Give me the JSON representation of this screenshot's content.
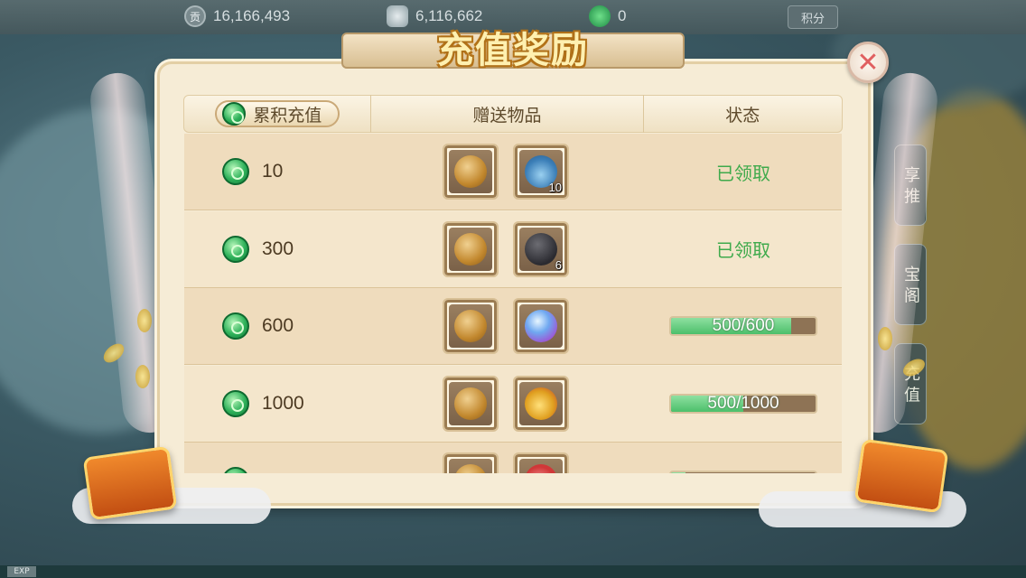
{
  "topbar": {
    "resources": [
      {
        "icon": "contribution-icon",
        "glyph": "贡",
        "value": "16,166,493"
      },
      {
        "icon": "silver-icon",
        "glyph": "",
        "value": "6,116,662"
      },
      {
        "icon": "jade-icon",
        "glyph": "",
        "value": "0"
      }
    ],
    "points_label": "积分"
  },
  "side_menu": [
    "享 推",
    "宝 阁",
    "充 值"
  ],
  "dialog": {
    "title": "充值奖励",
    "close_label": "✕",
    "columns": {
      "cumulative": "累积充值",
      "gifts": "赠送物品",
      "status": "状态"
    },
    "rows": [
      {
        "amount": "10",
        "items": [
          {
            "icon": "silver-bag-icon",
            "qty": ""
          },
          {
            "icon": "herb-vase-icon",
            "qty": "10"
          }
        ],
        "status_type": "claimed",
        "status": "已领取",
        "progress": null
      },
      {
        "amount": "300",
        "items": [
          {
            "icon": "silver-bag-icon",
            "qty": ""
          },
          {
            "icon": "black-stone-icon",
            "qty": "6"
          }
        ],
        "status_type": "claimed",
        "status": "已领取",
        "progress": null
      },
      {
        "amount": "600",
        "items": [
          {
            "icon": "silver-bag-icon",
            "qty": ""
          },
          {
            "icon": "crystal-orb-icon",
            "qty": ""
          }
        ],
        "status_type": "progress",
        "status": "500/600",
        "progress": 0.833
      },
      {
        "amount": "1000",
        "items": [
          {
            "icon": "silver-bag-icon",
            "qty": ""
          },
          {
            "icon": "lucky-bag-icon",
            "qty": ""
          }
        ],
        "status_type": "progress",
        "status": "500/1000",
        "progress": 0.5
      },
      {
        "amount": "",
        "items": [
          {
            "icon": "silver-bag-icon",
            "qty": ""
          },
          {
            "icon": "red-bag-icon",
            "qty": ""
          }
        ],
        "status_type": "progress",
        "status": "",
        "progress": 0.1
      }
    ]
  },
  "footer": {
    "exp_label": "EXP"
  },
  "colors": {
    "panel_bg": "#f6ecd6",
    "claimed_green": "#3faa4c",
    "progress_fill": "#4cbf6a",
    "title_gold": "#fff0b0",
    "close_red": "#e06060"
  }
}
